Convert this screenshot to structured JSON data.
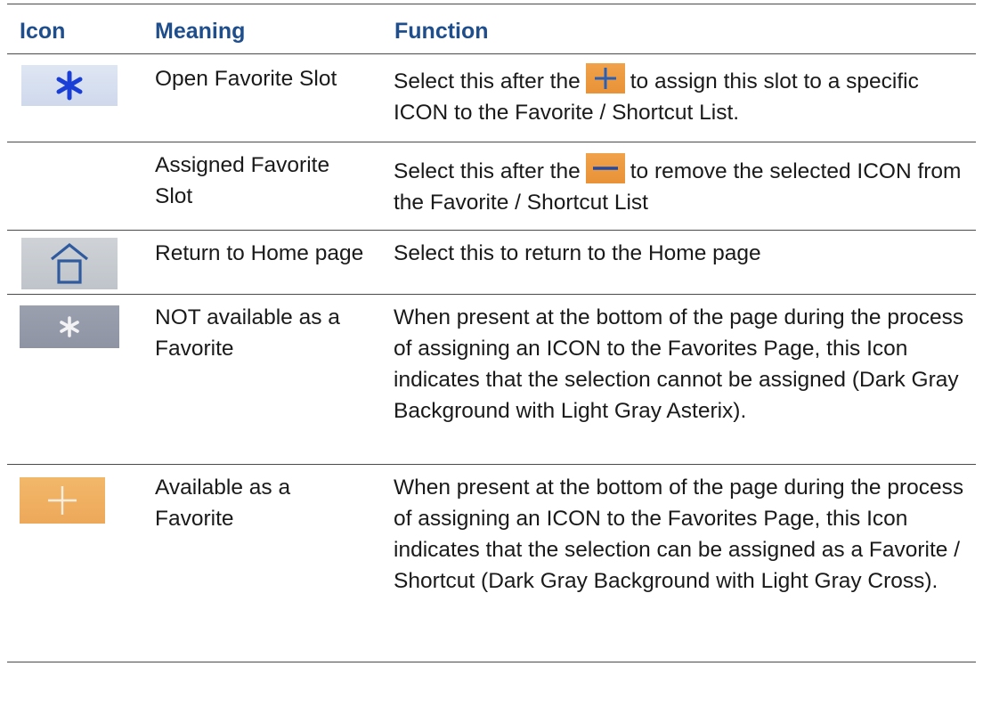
{
  "table": {
    "headers": {
      "icon": "Icon",
      "meaning": "Meaning",
      "function": "Function"
    },
    "rows": [
      {
        "icon": "blue-asterisk-icon",
        "meaning": "Open Favorite Slot",
        "function_before": "Select this after the",
        "inline_icon": "orange-plus-icon",
        "function_after": "to assign this slot to a specific ICON to the Favorite / Shortcut List."
      },
      {
        "icon": "",
        "meaning": "Assigned Favorite Slot",
        "function_before": "Select this after the",
        "inline_icon": "orange-minus-icon",
        "function_after": "to remove the selected ICON from the Favorite / Shortcut List"
      },
      {
        "icon": "home-icon",
        "meaning": "Return to Home page",
        "function": "Select this to return to the Home page"
      },
      {
        "icon": "gray-asterisk-icon",
        "meaning": "NOT available as a Favorite",
        "function": "When present at the bottom of the page during the process of assigning an ICON to the Favorites Page, this Icon indicates that the selection cannot be assigned (Dark Gray Background with Light Gray Asterix)."
      },
      {
        "icon": "plus-icon",
        "meaning": "Available as a Favorite",
        "function": "When present at the bottom of the page during the process of assigning an ICON to the Favorites Page, this Icon indicates that the selection can be assigned as a Favorite / Shortcut (Dark Gray Background with Light Gray Cross)."
      }
    ]
  },
  "colors": {
    "header_text": "#1f4e8c",
    "rule": "#4a4a4a",
    "asterisk_blue": "#1a3fd6",
    "home_blue": "#2f5a9e",
    "orange_button": "#ec9a40"
  }
}
